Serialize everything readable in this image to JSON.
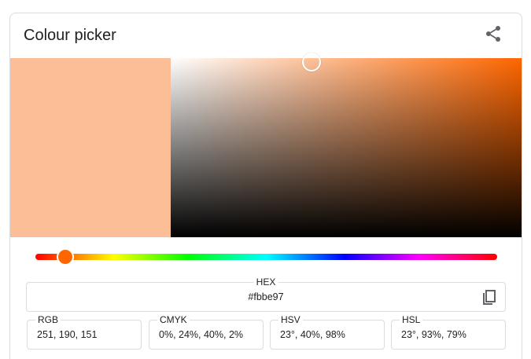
{
  "card": {
    "title": "Colour picker"
  },
  "icons": {
    "share": "share-icon",
    "copy": "copy-icon"
  },
  "color": {
    "preview_hex": "#fbbe97",
    "hue_color": "#ff6600",
    "hue_degrees": 23,
    "saturation_percent": 40,
    "value_percent": 98
  },
  "fields": {
    "hex": {
      "label": "HEX",
      "value": "#fbbe97"
    },
    "rgb": {
      "label": "RGB",
      "value": "251, 190, 151"
    },
    "cmyk": {
      "label": "CMYK",
      "value": "0%, 24%, 40%, 2%"
    },
    "hsv": {
      "label": "HSV",
      "value": "23°, 40%, 98%"
    },
    "hsl": {
      "label": "HSL",
      "value": "23°, 93%, 79%"
    }
  }
}
